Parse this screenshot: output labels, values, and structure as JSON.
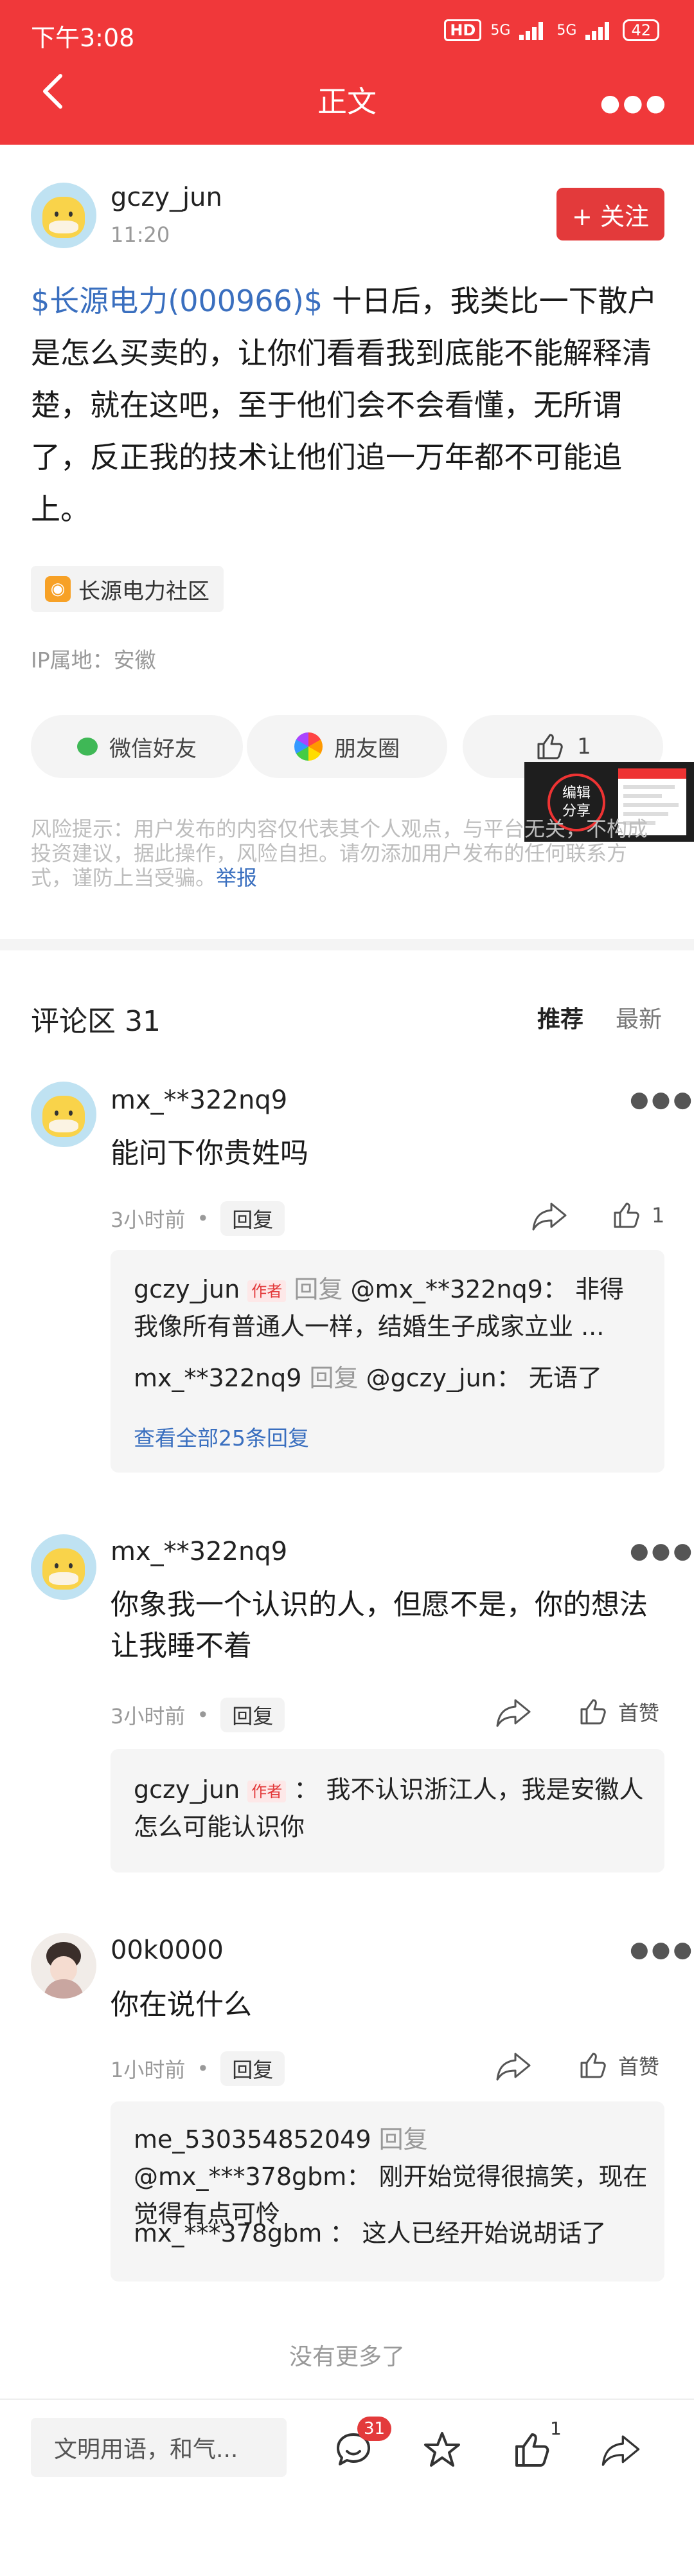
{
  "status_bar": {
    "time": "下午3:08",
    "hd": "HD",
    "net1": "5G",
    "net2": "5G",
    "battery": "42"
  },
  "header": {
    "title": "正文"
  },
  "post": {
    "author": "gczy_jun",
    "time": "11:20",
    "follow_label": "+ 关注",
    "stock_tag": "$长源电力(000966)$",
    "body": " 十日后，我类比一下散户是怎么买卖的，让你们看看我到底能不能解释清楚，就在这吧，至于他们会不会看懂，无所谓了，反正我的技术让他们追一万年都不可能追上。",
    "community": "长源电力社区",
    "ip": "IP属地：安徽",
    "share_wechat": "微信好友",
    "share_moments": "朋友圈",
    "like_count": "1",
    "edit_share": "编辑\n分享",
    "risk": "风险提示：用户发布的内容仅代表其个人观点，与平台无关，不构成投资建议，据此操作，风险自担。请勿添加用户发布的任何联系方式，谨防上当受骗。",
    "report": "举报"
  },
  "comments_section": {
    "title": "评论区 31",
    "sort_recommend": "推荐",
    "sort_latest": "最新"
  },
  "comments": [
    {
      "name": "mx_**322nq9",
      "text": "能问下你贵姓吗",
      "time": "3小时前",
      "reply": "回复",
      "like": "1",
      "replies": [
        {
          "name": "gczy_jun",
          "badge": "作者",
          "mid": " 回复 ",
          "target": "@mx_**322nq9：",
          "text": " 非得我像所有普通人一样，结婚生子成家立业 ..."
        },
        {
          "name": "mx_**322nq9",
          "mid": " 回复 ",
          "target": "@gczy_jun：",
          "text": " 无语了"
        }
      ],
      "view_all": "查看全部25条回复"
    },
    {
      "name": "mx_**322nq9",
      "text": "你象我一个认识的人，但愿不是，你的想法让我睡不着",
      "time": "3小时前",
      "reply": "回复",
      "like": "首赞",
      "replies": [
        {
          "name": "gczy_jun",
          "badge": "作者",
          "text": " ： 我不认识浙江人，我是安徽人怎么可能认识你"
        }
      ]
    },
    {
      "name": "00k0000",
      "text": "你在说什么",
      "time": "1小时前",
      "reply": "回复",
      "like": "首赞",
      "replies": [
        {
          "name": "me_530354852049",
          "mid": " 回复 ",
          "target": "@mx_***378gbm：",
          "text": " 刚开始觉得很搞笑，现在觉得有点可怜"
        },
        {
          "name": "mx_***378gbm",
          "text": " ： 这人已经开始说胡话了"
        }
      ]
    }
  ],
  "no_more": "没有更多了",
  "bottom_bar": {
    "input_placeholder": "文明用语，和气...",
    "comment_badge": "31",
    "like_count": "1"
  }
}
